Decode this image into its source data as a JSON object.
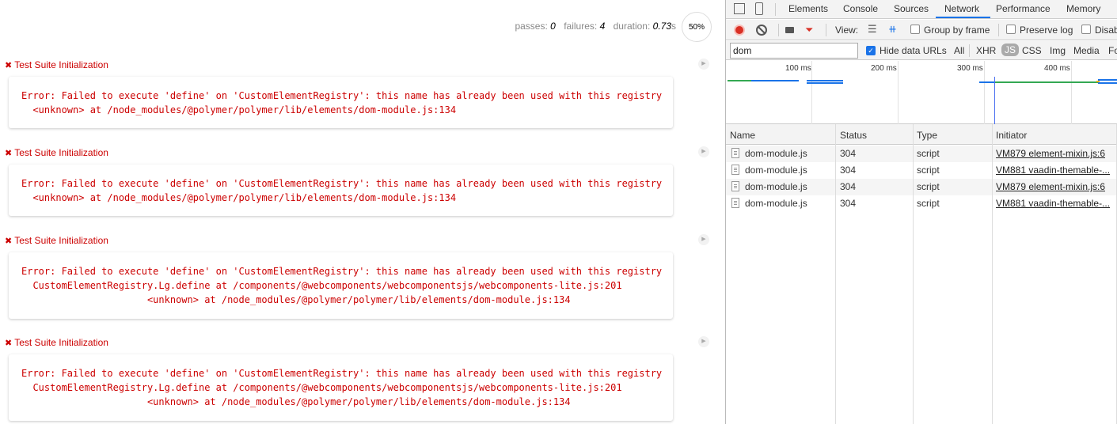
{
  "report": {
    "stats": {
      "passes_label": "passes:",
      "passes": "0",
      "failures_label": "failures:",
      "failures": "4",
      "duration_label": "duration:",
      "duration": "0.73",
      "duration_unit": "s"
    },
    "progress": "50%",
    "fail_icon": "✖",
    "suites": [
      {
        "title": "Test Suite Initialization",
        "message": "Error: Failed to execute 'define' on 'CustomElementRegistry': this name has already been used with this registry\n  <unknown> at /node_modules/@polymer/polymer/lib/elements/dom-module.js:134"
      },
      {
        "title": "Test Suite Initialization",
        "message": "Error: Failed to execute 'define' on 'CustomElementRegistry': this name has already been used with this registry\n  <unknown> at /node_modules/@polymer/polymer/lib/elements/dom-module.js:134"
      },
      {
        "title": "Test Suite Initialization",
        "message": "Error: Failed to execute 'define' on 'CustomElementRegistry': this name has already been used with this registry\n  CustomElementRegistry.Lg.define at /components/@webcomponents/webcomponentsjs/webcomponents-lite.js:201\n                      <unknown> at /node_modules/@polymer/polymer/lib/elements/dom-module.js:134"
      },
      {
        "title": "Test Suite Initialization",
        "message": "Error: Failed to execute 'define' on 'CustomElementRegistry': this name has already been used with this registry\n  CustomElementRegistry.Lg.define at /components/@webcomponents/webcomponentsjs/webcomponents-lite.js:201\n                      <unknown> at /node_modules/@polymer/polymer/lib/elements/dom-module.js:134"
      }
    ]
  },
  "devtools": {
    "tabs": [
      "Elements",
      "Console",
      "Sources",
      "Network",
      "Performance",
      "Memory"
    ],
    "active_tab": "Network",
    "toolbar": {
      "view_label": "View:",
      "group_by_frame": "Group by frame",
      "preserve_log": "Preserve log",
      "disable_cache": "Disab"
    },
    "filter": {
      "value": "dom",
      "hide_data_urls": "Hide data URLs",
      "types": [
        "All",
        "XHR",
        "JS",
        "CSS",
        "Img",
        "Media",
        "Fo"
      ],
      "selected_type": "JS"
    },
    "timeline_ticks": [
      "100 ms",
      "200 ms",
      "300 ms",
      "400 ms"
    ],
    "columns": [
      "Name",
      "Status",
      "Type",
      "Initiator"
    ],
    "rows": [
      {
        "name": "dom-module.js",
        "status": "304",
        "type": "script",
        "initiator": "VM879 element-mixin.js:6"
      },
      {
        "name": "dom-module.js",
        "status": "304",
        "type": "script",
        "initiator": "VM881 vaadin-themable-..."
      },
      {
        "name": "dom-module.js",
        "status": "304",
        "type": "script",
        "initiator": "VM879 element-mixin.js:6"
      },
      {
        "name": "dom-module.js",
        "status": "304",
        "type": "script",
        "initiator": "VM881 vaadin-themable-..."
      }
    ],
    "colors": {
      "accent": "#1a73e8",
      "record": "#d93025",
      "error_text": "#c00"
    }
  }
}
